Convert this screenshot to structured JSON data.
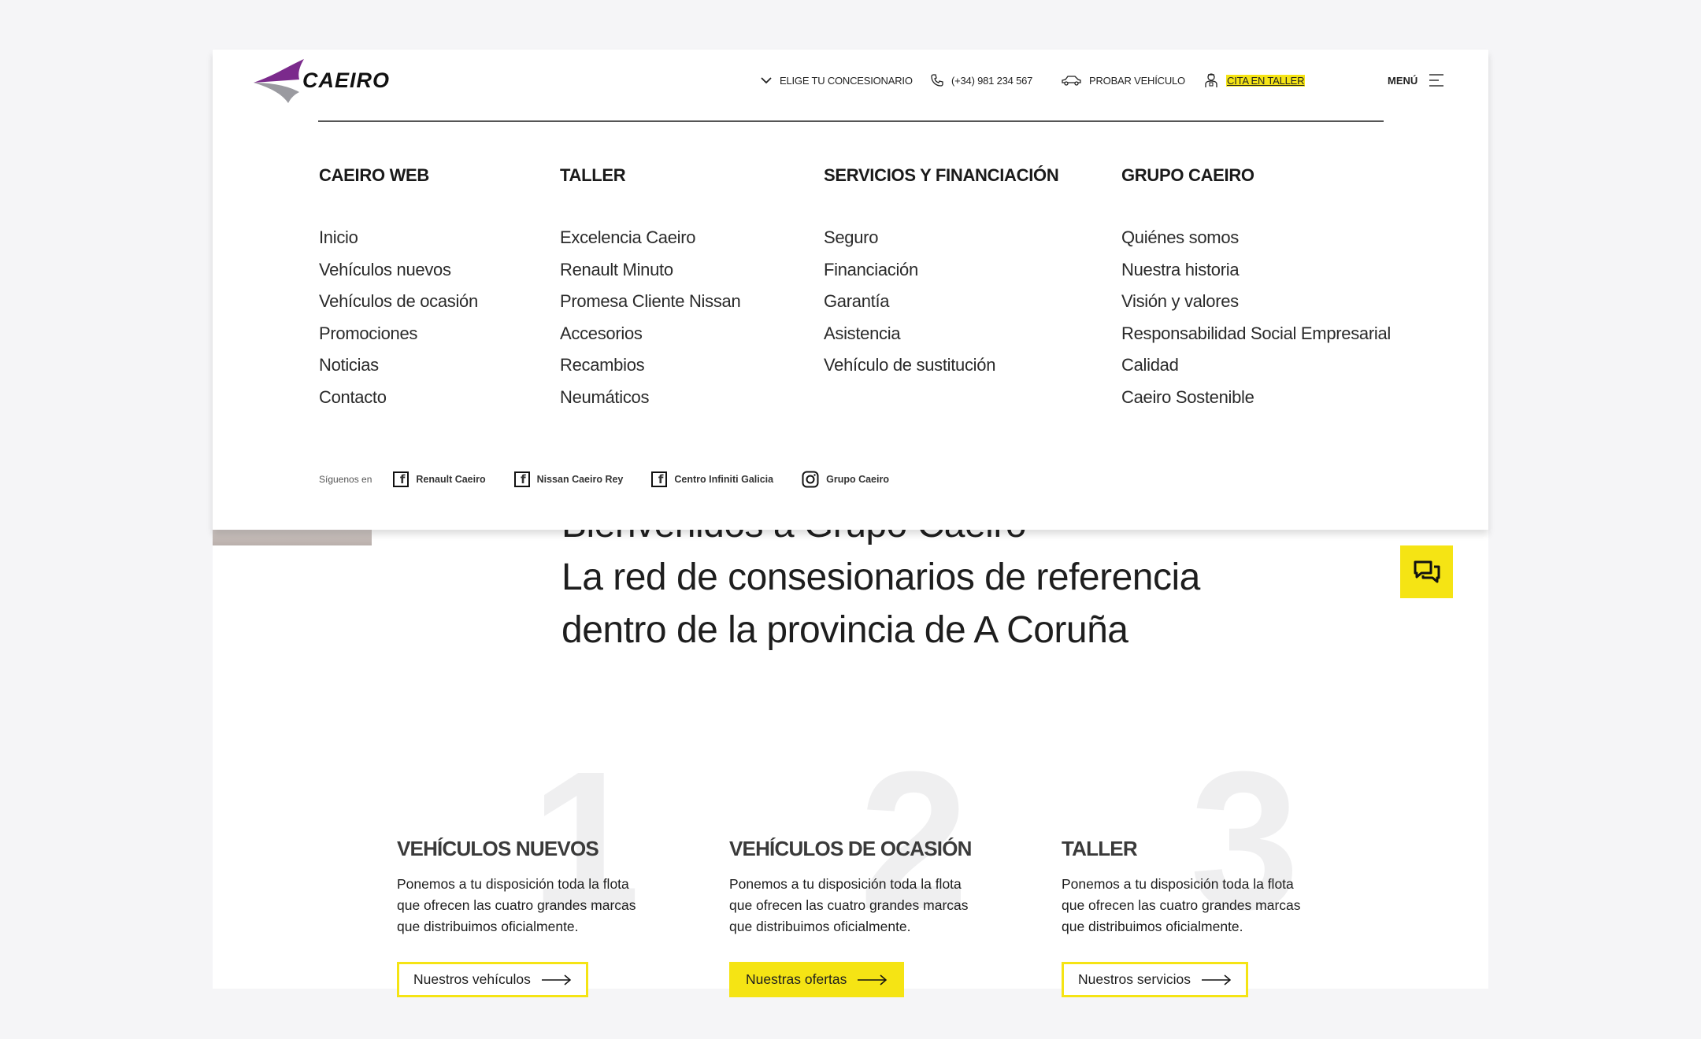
{
  "header": {
    "logo_text": "CAEIRO",
    "nav": [
      {
        "label": "ELIGE TU CONCESIONARIO",
        "icon": "chevron-down-icon"
      },
      {
        "label": "(+34) 981 234 567",
        "icon": "phone-icon"
      },
      {
        "label": "PROBAR VEHÍCULO",
        "icon": "car-icon"
      },
      {
        "label": "CITA EN TALLER",
        "icon": "mechanic-icon"
      }
    ],
    "menu_label": "MENÚ"
  },
  "menu": {
    "columns": [
      {
        "title": "CAEIRO WEB",
        "items": [
          "Inicio",
          "Vehículos nuevos",
          "Vehículos de ocasión",
          "Promociones",
          "Noticias",
          "Contacto"
        ]
      },
      {
        "title": "TALLER",
        "items": [
          "Excelencia Caeiro",
          "Renault Minuto",
          "Promesa Cliente Nissan",
          "Accesorios",
          "Recambios",
          "Neumáticos"
        ]
      },
      {
        "title": "SERVICIOS Y FINANCIACIÓN",
        "items": [
          "Seguro",
          "Financiación",
          "Garantía",
          "Asistencia",
          "Vehículo de sustitución"
        ]
      },
      {
        "title": "GRUPO CAEIRO",
        "items": [
          "Quiénes somos",
          "Nuestra historia",
          "Visión y valores",
          "Responsabilidad Social Empresarial",
          "Calidad",
          "Caeiro Sostenible"
        ]
      }
    ],
    "social_label": "Síguenos en",
    "social": [
      {
        "label": "Renault Caeiro",
        "icon": "facebook-icon"
      },
      {
        "label": "Nissan Caeiro Rey",
        "icon": "facebook-icon"
      },
      {
        "label": "Centro Infiniti Galicia",
        "icon": "facebook-icon"
      },
      {
        "label": "Grupo Caeiro",
        "icon": "instagram-icon"
      }
    ]
  },
  "hero": {
    "line1": "Bienvenidos a Grupo Caeiro",
    "line2": "La red de consesionarios de referencia",
    "line3": "dentro de la provincia de A Coruña"
  },
  "features": [
    {
      "number": "1",
      "title": "VEHÍCULOS NUEVOS",
      "text": "Ponemos a tu disposición toda la flota que ofrecen las cuatro grandes marcas que distribuimos oficialmente.",
      "cta": "Nuestros vehículos"
    },
    {
      "number": "2",
      "title": "VEHÍCULOS DE OCASIÓN",
      "text": "Ponemos a tu disposición toda la flota que ofrecen las cuatro grandes marcas que distribuimos oficialmente.",
      "cta": "Nuestras ofertas"
    },
    {
      "number": "3",
      "title": "TALLER",
      "text": "Ponemos a tu disposición toda la flota que ofrecen las cuatro grandes marcas que distribuimos oficialmente.",
      "cta": "Nuestros servicios"
    }
  ],
  "colors": {
    "accent": "#f5e414",
    "logo_purple": "#7b2a8c",
    "text": "#1e1e1e"
  }
}
